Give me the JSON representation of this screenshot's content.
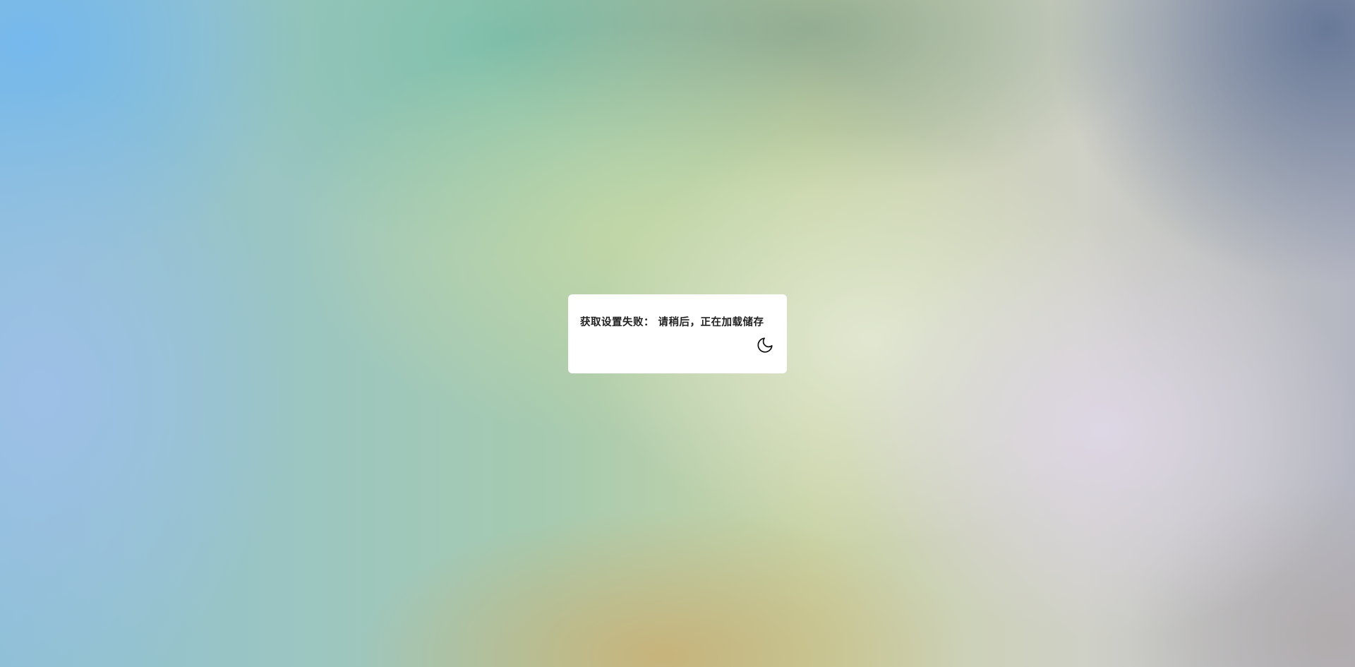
{
  "dialog": {
    "message": "获取设置失败： 请稍后，正在加载储存",
    "theme_toggle_icon": "moon-icon"
  },
  "colors": {
    "dialog_background": "#ffffff",
    "text": "#222222"
  }
}
